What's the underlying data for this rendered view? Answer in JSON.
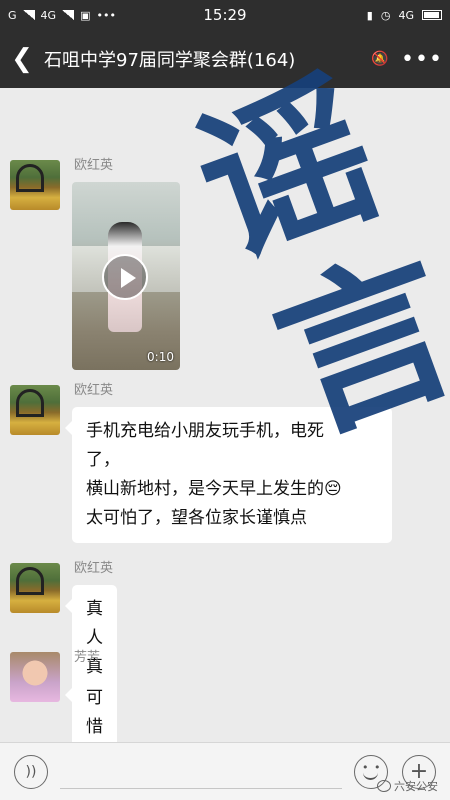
{
  "status_bar": {
    "left": [
      "G",
      "4G"
    ],
    "time": "15:29",
    "right": "4G"
  },
  "header": {
    "title": "石咀中学97届同学聚会群(164)"
  },
  "messages": [
    {
      "sender": "欧红英",
      "type": "video",
      "duration": "0:10"
    },
    {
      "sender": "欧红英",
      "type": "text",
      "lines": [
        "手机充电给小朋友玩手机，电死",
        "了，",
        "横山新地村，是今天早上发生的😔",
        "太可怕了，望各位家长谨慎点"
      ]
    },
    {
      "sender": "欧红英",
      "type": "text",
      "text": "真人真事来的"
    },
    {
      "sender": "芳芳",
      "type": "text",
      "text": "可惜的小孩"
    }
  ],
  "stamp": {
    "line1": "谣",
    "line2": "言",
    "color": "#17407a"
  },
  "watermark": "六安公安",
  "colors": {
    "header_bg": "#2e2e2e",
    "chat_bg": "#ebebeb",
    "bubble_bg": "#ffffff"
  }
}
